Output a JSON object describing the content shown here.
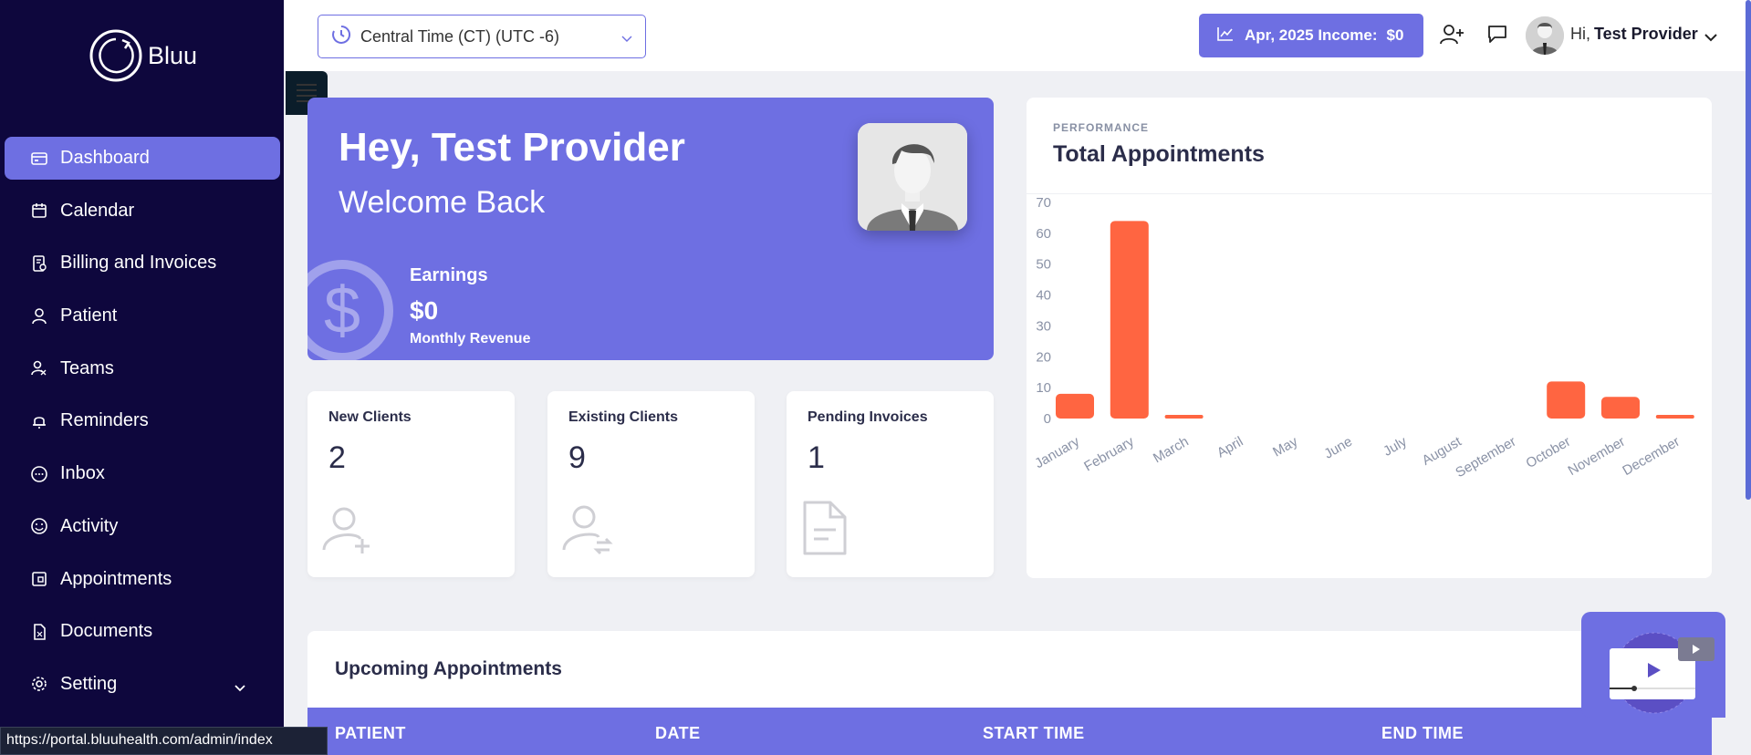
{
  "app": {
    "name": "Bluu"
  },
  "sidebar": {
    "items": [
      {
        "label": "Dashboard",
        "icon": "dashboard-icon",
        "active": true
      },
      {
        "label": "Calendar",
        "icon": "calendar-icon"
      },
      {
        "label": "Billing and Invoices",
        "icon": "invoice-icon"
      },
      {
        "label": "Patient",
        "icon": "user-icon"
      },
      {
        "label": "Teams",
        "icon": "team-icon"
      },
      {
        "label": "Reminders",
        "icon": "bell-icon"
      },
      {
        "label": "Inbox",
        "icon": "chat-icon"
      },
      {
        "label": "Activity",
        "icon": "activity-icon"
      },
      {
        "label": "Appointments",
        "icon": "appointment-icon"
      },
      {
        "label": "Documents",
        "icon": "document-icon"
      },
      {
        "label": "Setting",
        "icon": "gear-icon"
      }
    ]
  },
  "topbar": {
    "timezone": "Central Time (CT) (UTC -6)",
    "income_label": "Apr, 2025 Income:",
    "income_value": "$0",
    "greeting": "Hi,",
    "user_name": "Test Provider"
  },
  "welcome": {
    "title": "Hey, Test Provider",
    "subtitle": "Welcome Back",
    "dollar_symbol": "$",
    "earnings_label": "Earnings",
    "earnings_value": "$0",
    "earnings_sub": "Monthly Revenue"
  },
  "stats": [
    {
      "label": "New Clients",
      "value": "2",
      "icon": "add-user-icon"
    },
    {
      "label": "Existing Clients",
      "value": "9",
      "icon": "user-swap-icon"
    },
    {
      "label": "Pending Invoices",
      "value": "1",
      "icon": "file-icon"
    }
  ],
  "chart_section": {
    "eyebrow": "PERFORMANCE",
    "title": "Total Appointments"
  },
  "chart_data": {
    "type": "bar",
    "title": "Total Appointments",
    "categories": [
      "January",
      "February",
      "March",
      "April",
      "May",
      "June",
      "July",
      "August",
      "September",
      "October",
      "November",
      "December"
    ],
    "values": [
      8,
      64,
      1,
      0,
      0,
      0,
      0,
      0,
      0,
      12,
      7,
      1
    ],
    "ylim": [
      0,
      70
    ],
    "yticks": [
      0,
      10,
      20,
      30,
      40,
      50,
      60,
      70
    ],
    "color": "#ff6541",
    "grid": false
  },
  "upcoming": {
    "title": "Upcoming Appointments",
    "columns": [
      "PATIENT",
      "DATE",
      "START TIME",
      "END TIME"
    ]
  },
  "status_url": "https://portal.bluuhealth.com/admin/index",
  "colors": {
    "sidebar": "#0e073d",
    "accent": "#6e6fe2",
    "bar": "#ff6541"
  }
}
